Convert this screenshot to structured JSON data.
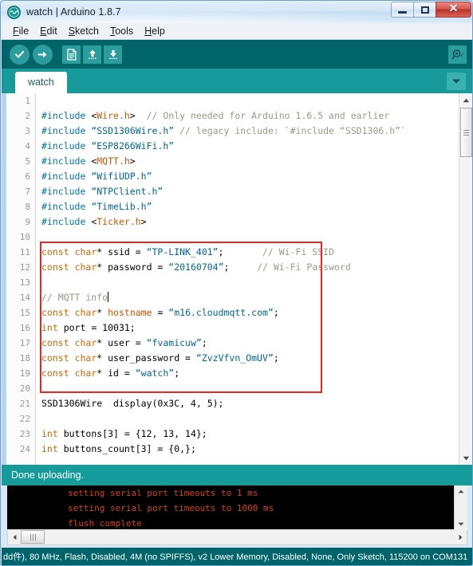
{
  "window": {
    "title": "watch | Arduino 1.8.7",
    "logo_icon": "arduino-infinity-icon",
    "controls": {
      "minimize": "minimize-icon",
      "maximize": "maximize-icon",
      "close": "✕"
    }
  },
  "menubar": {
    "items": [
      {
        "label": "File",
        "accel": "F"
      },
      {
        "label": "Edit",
        "accel": "E"
      },
      {
        "label": "Sketch",
        "accel": "S"
      },
      {
        "label": "Tools",
        "accel": "T"
      },
      {
        "label": "Help",
        "accel": "H"
      }
    ]
  },
  "toolbar": {
    "verify": "verify-icon",
    "upload": "upload-icon",
    "new": "new-sketch-icon",
    "open": "open-sketch-icon",
    "save": "save-sketch-icon",
    "serial_monitor": "serial-monitor-icon"
  },
  "tabs": {
    "items": [
      {
        "label": "watch",
        "active": true
      }
    ],
    "dropdown_icon": "chevron-down-icon"
  },
  "editor": {
    "lines": [
      {
        "n": "1",
        "html": ""
      },
      {
        "n": "2",
        "html": "<span class=\"kw2\">#include</span> &lt;<span class=\"lib\">Wire.h</span>&gt;  <span class=\"cmt\">// Only needed for Arduino 1.6.5 and earlier</span>"
      },
      {
        "n": "3",
        "html": "<span class=\"kw2\">#include</span> <span class=\"str\">“SSD1306Wire.h”</span> <span class=\"cmt\">// legacy include: `#include “SSD1306.h”`</span>"
      },
      {
        "n": "4",
        "html": "<span class=\"kw2\">#include</span> <span class=\"str\">“ESP8266WiFi.h”</span>"
      },
      {
        "n": "5",
        "html": "<span class=\"kw2\">#include</span> &lt;<span class=\"lib\">MQTT.h</span>&gt;"
      },
      {
        "n": "6",
        "html": "<span class=\"kw2\">#include</span> <span class=\"str\">“WifiUDP.h”</span>"
      },
      {
        "n": "7",
        "html": "<span class=\"kw2\">#include</span> <span class=\"str\">“NTPClient.h”</span>"
      },
      {
        "n": "8",
        "html": "<span class=\"kw2\">#include</span> <span class=\"str\">“TimeLib.h”</span>"
      },
      {
        "n": "9",
        "html": "<span class=\"kw2\">#include</span> &lt;<span class=\"lib\">Ticker.h</span>&gt;"
      },
      {
        "n": "10",
        "html": ""
      },
      {
        "n": "11",
        "html": "<span class=\"kw\">const</span> <span class=\"kw\">char</span>* ssid = <span class=\"str\">“TP-LINK_401”</span>;       <span class=\"cmt\">// Wi-Fi SSID</span>"
      },
      {
        "n": "12",
        "html": "<span class=\"kw\">const</span> <span class=\"kw\">char</span>* password = <span class=\"str\">“20160704”</span>;     <span class=\"cmt\">// Wi-Fi Password</span>"
      },
      {
        "n": "13",
        "html": ""
      },
      {
        "n": "14",
        "html": "<span class=\"cmt\">// MQTT info</span><span class=\"caret\"></span>"
      },
      {
        "n": "15",
        "html": "<span class=\"kw\">const</span> <span class=\"kw\">char</span>* <span class=\"lib\">hostname</span> = <span class=\"str\">“m16.cloudmqtt.com”</span>;"
      },
      {
        "n": "16",
        "html": "<span class=\"kw\">int</span> port = 10031;"
      },
      {
        "n": "17",
        "html": "<span class=\"kw\">const</span> <span class=\"kw\">char</span>* user = <span class=\"str\">“fvamicuw”</span>;"
      },
      {
        "n": "18",
        "html": "<span class=\"kw\">const</span> <span class=\"kw\">char</span>* user_password = <span class=\"str\">“ZvzVfvn_OmUV”</span>;"
      },
      {
        "n": "19",
        "html": "<span class=\"kw\">const</span> <span class=\"kw\">char</span>* id = <span class=\"str\">“watch”</span>;"
      },
      {
        "n": "20",
        "html": ""
      },
      {
        "n": "21",
        "html": "SSD1306Wire  display(0x3C, 4, 5);"
      },
      {
        "n": "22",
        "html": ""
      },
      {
        "n": "23",
        "html": "<span class=\"kw\">int</span> buttons[3] = {12, 13, 14};"
      },
      {
        "n": "24",
        "html": "<span class=\"kw\">int</span> buttons_count[3] = {0,};"
      }
    ],
    "annotation": {
      "type": "red-rectangle",
      "color": "#ee2222",
      "covers_lines": "11-19"
    }
  },
  "status_message": "Done uploading.",
  "console": {
    "lines": [
      "setting serial port timeouts to 1 ms",
      "setting serial port timeouts to 1000 ms",
      "flush complete"
    ],
    "text_color": "#d9420c",
    "background": "#000000"
  },
  "board_status": "dd件), 80 MHz, Flash, Disabled, 4M (no SPIFFS), v2 Lower Memory, Disabled, None, Only Sketch, 115200 on COM131"
}
